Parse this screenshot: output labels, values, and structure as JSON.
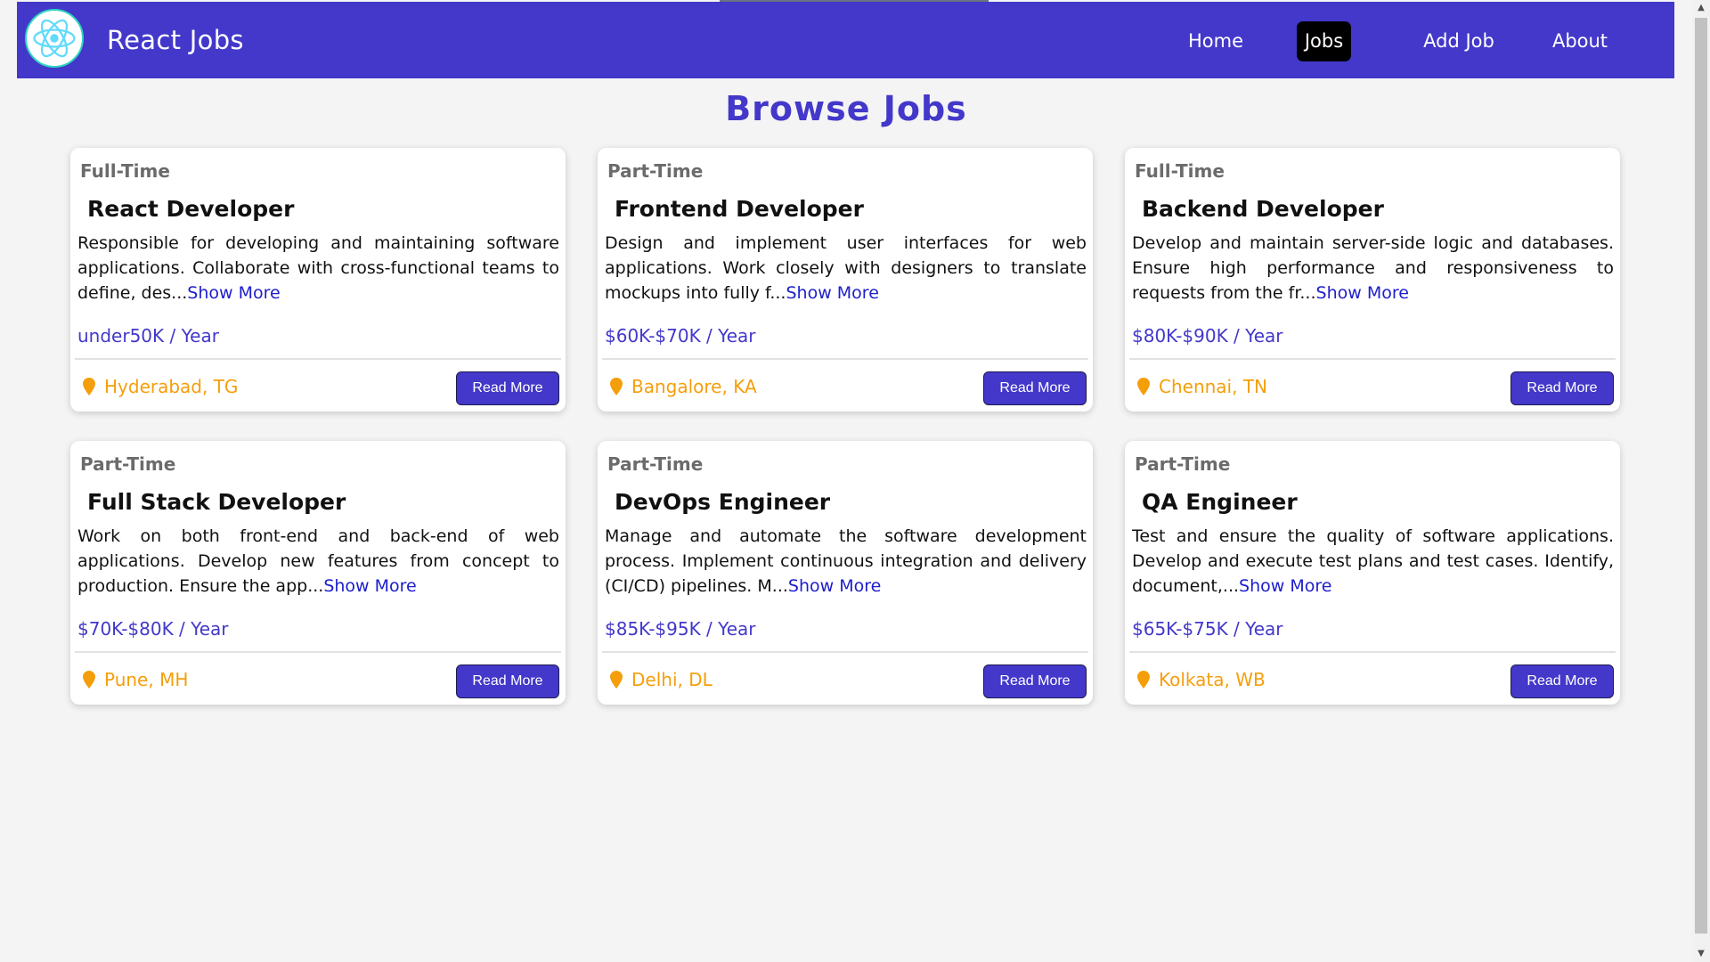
{
  "app": {
    "brand": "React Jobs"
  },
  "nav": {
    "items": [
      {
        "label": "Home"
      },
      {
        "label": "Jobs"
      },
      {
        "label": "Add Job"
      },
      {
        "label": "About"
      }
    ],
    "active": "Jobs"
  },
  "page": {
    "title": "Browse Jobs"
  },
  "jobs": [
    {
      "type": "Full-Time",
      "title": "React Developer",
      "description": "Responsible for developing and maintaining software applications. Collaborate with cross-functional teams to define, des...",
      "show_more": "Show More",
      "salary": "under50K / Year",
      "location": "Hyderabad, TG",
      "button": "Read More"
    },
    {
      "type": "Part-Time",
      "title": "Frontend Developer",
      "description": "Design and implement user interfaces for web applications. Work closely with designers to translate mockups into fully f...",
      "show_more": "Show More",
      "salary": "$60K-$70K / Year",
      "location": "Bangalore, KA",
      "button": "Read More"
    },
    {
      "type": "Full-Time",
      "title": "Backend Developer",
      "description": "Develop and maintain server-side logic and databases. Ensure high performance and responsiveness to requests from the fr...",
      "show_more": "Show More",
      "salary": "$80K-$90K / Year",
      "location": "Chennai, TN",
      "button": "Read More"
    },
    {
      "type": "Part-Time",
      "title": "Full Stack Developer",
      "description": "Work on both front-end and back-end of web applications. Develop new features from concept to production. Ensure the app...",
      "show_more": "Show More",
      "salary": "$70K-$80K / Year",
      "location": "Pune, MH",
      "button": "Read More"
    },
    {
      "type": "Part-Time",
      "title": "DevOps Engineer",
      "description": "Manage and automate the software development process. Implement continuous integration and delivery (CI/CD) pipelines. M...",
      "show_more": "Show More",
      "salary": "$85K-$95K / Year",
      "location": "Delhi, DL",
      "button": "Read More"
    },
    {
      "type": "Part-Time",
      "title": "QA Engineer",
      "description": "Test and ensure the quality of software applications. Develop and execute test plans and test cases. Identify, document,...",
      "show_more": "Show More",
      "salary": "$65K-$75K / Year",
      "location": "Kolkata, WB",
      "button": "Read More"
    }
  ],
  "colors": {
    "primary": "#4338ca",
    "location": "#f59e0b",
    "link": "#1d1dcc"
  }
}
